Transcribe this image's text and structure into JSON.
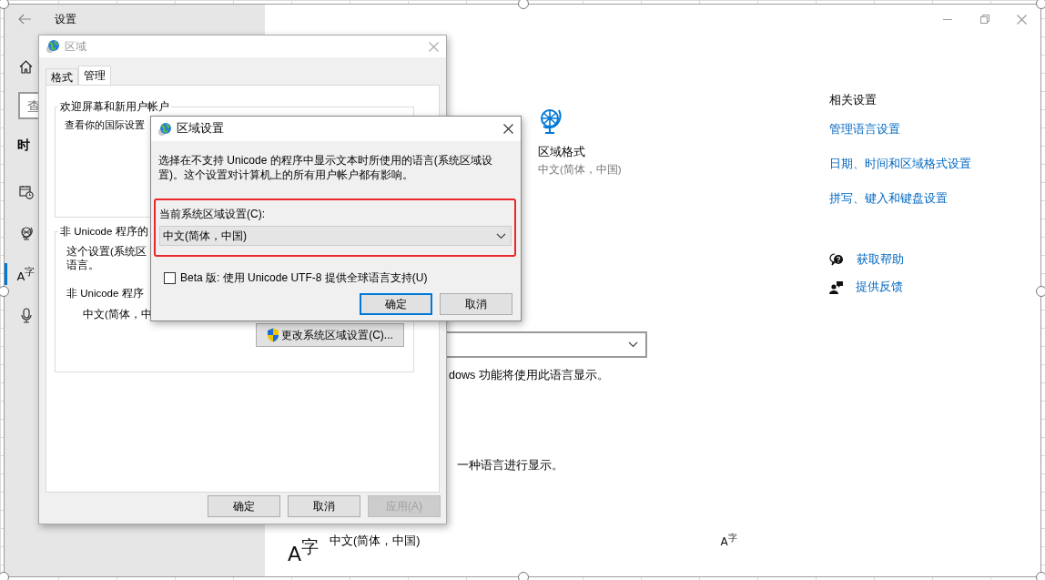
{
  "settings_window": {
    "title": "设置",
    "search": {
      "placeholder": "查"
    },
    "section_heading": "时",
    "nav_items": [
      {
        "kind": "date",
        "selected": false
      },
      {
        "kind": "region",
        "selected": false
      },
      {
        "kind": "language",
        "icon_text": "A$^{字}$",
        "selected": true
      },
      {
        "kind": "speech",
        "selected": false
      }
    ],
    "region_format": {
      "title": "区域格式",
      "value": "中文(简体，中国)"
    },
    "display_language_note": "dows 功能将使用此语言显示。",
    "preferred_note": "一种语言进行显示。",
    "preferred_language": {
      "icon_text": "A$^{字}$",
      "name": "中文(简体，中国)",
      "option_icon_text": "A$^{字}$"
    },
    "related_settings": {
      "title": "相关设置",
      "links": [
        "管理语言设置",
        "日期、时间和区域格式设置",
        "拼写、键入和键盘设置"
      ]
    },
    "help_links": [
      {
        "kind": "help",
        "label": "获取帮助"
      },
      {
        "kind": "feedback",
        "label": "提供反馈"
      }
    ]
  },
  "region_dialog": {
    "title": "区域",
    "tabs": [
      {
        "label": "格式",
        "selected": false
      },
      {
        "label": "管理",
        "selected": true
      }
    ],
    "welcome_group": {
      "title": "欢迎屏幕和新用户帐户",
      "lines": [
        "查看你的国际设置"
      ]
    },
    "unicode_group": {
      "title": "非 Unicode 程序的",
      "lines": [
        "这个设置(系统区",
        "语言。"
      ],
      "current_label": "非 Unicode 程序",
      "current_value": "中文(简体，中",
      "change_button": "更改系统区域设置(C)..."
    },
    "buttons": [
      {
        "label": "确定",
        "disabled": false
      },
      {
        "label": "取消",
        "disabled": false
      },
      {
        "label": "应用(A)",
        "disabled": true
      }
    ]
  },
  "locale_dialog": {
    "title": "区域设置",
    "description": "选择在不支持 Unicode 的程序中显示文本时所使用的语言(系统区域设置)。这个设置对计算机上的所有用户帐户都有影响。",
    "current_label": "当前系统区域设置(C):",
    "current_value": "中文(简体，中国)",
    "beta": {
      "label": "Beta 版: 使用 Unicode UTF-8 提供全球语言支持(U)",
      "checked": false
    },
    "buttons": [
      {
        "label": "确定",
        "default": true
      },
      {
        "label": "取消",
        "default": false
      }
    ]
  }
}
